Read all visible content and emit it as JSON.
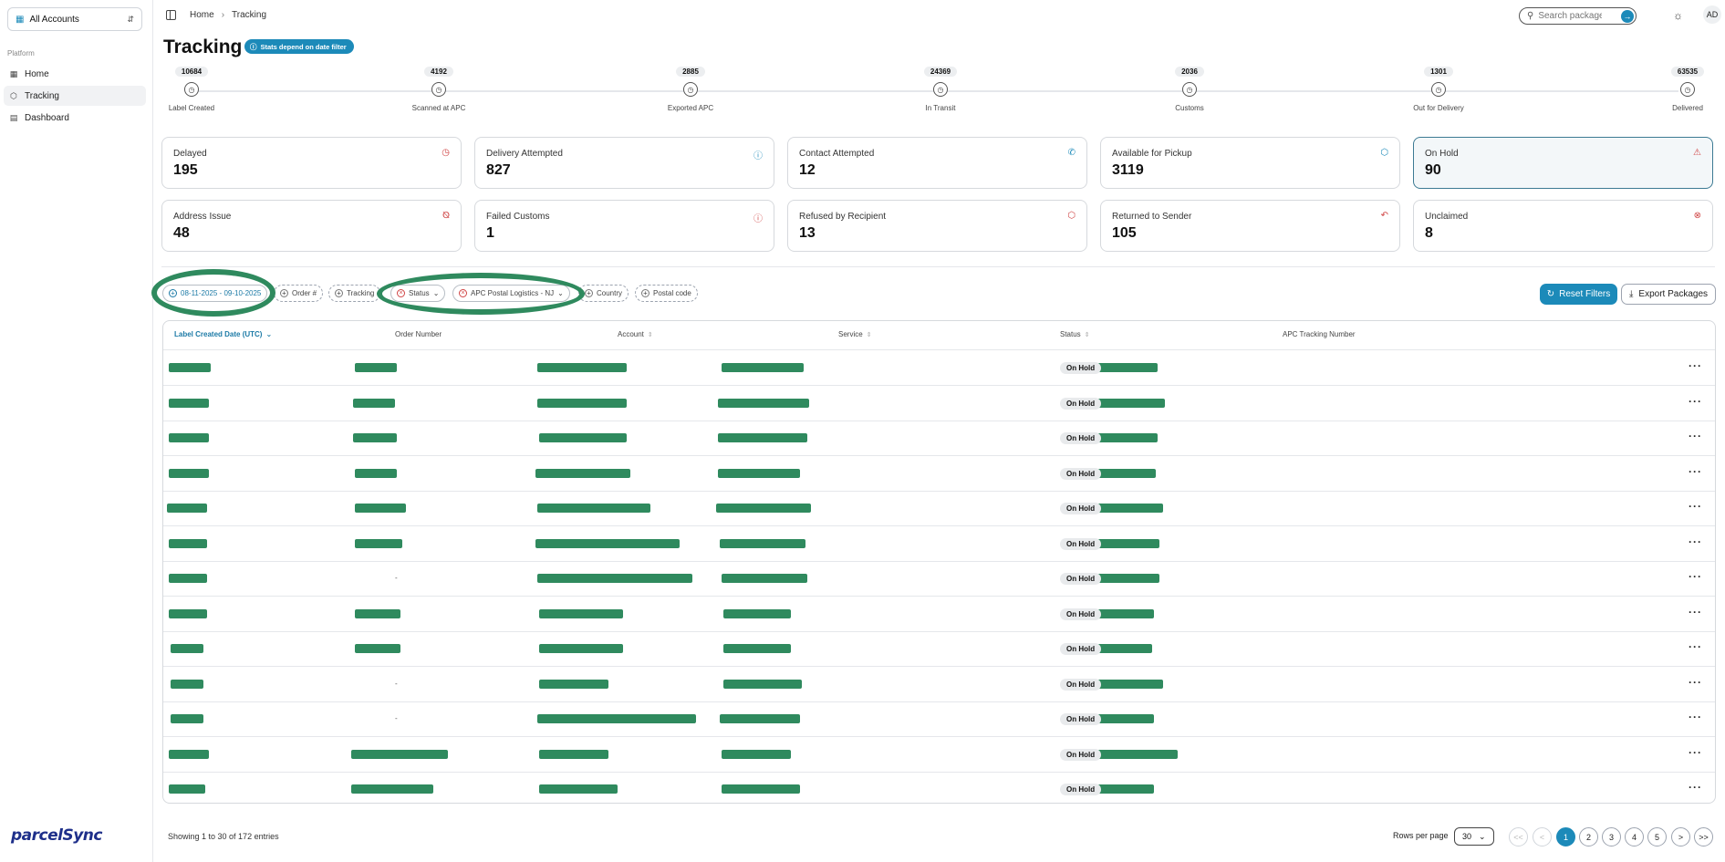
{
  "sidebar": {
    "account_select": "All Accounts",
    "section": "Platform",
    "items": [
      {
        "label": "Home",
        "icon": "grid-icon"
      },
      {
        "label": "Tracking",
        "icon": "package-icon"
      },
      {
        "label": "Dashboard",
        "icon": "document-icon"
      }
    ],
    "brand": "parcelSync"
  },
  "header": {
    "breadcrumb": [
      "Home",
      "Tracking"
    ],
    "search_placeholder": "Search packages...",
    "avatar": "AD"
  },
  "page": {
    "title": "Tracking",
    "stats_badge": "Stats depend on date filter"
  },
  "steps": [
    {
      "count": "10684",
      "label": "Label Created"
    },
    {
      "count": "4192",
      "label": "Scanned at APC"
    },
    {
      "count": "2885",
      "label": "Exported APC"
    },
    {
      "count": "24369",
      "label": "In Transit"
    },
    {
      "count": "2036",
      "label": "Customs"
    },
    {
      "count": "1301",
      "label": "Out for Delivery"
    },
    {
      "count": "63535",
      "label": "Delivered"
    }
  ],
  "cards": [
    {
      "name": "Delayed",
      "value": "195",
      "icon": "clock-icon",
      "color": "#d04545"
    },
    {
      "name": "Delivery Attempted",
      "value": "827",
      "icon": "help-circle-icon",
      "color": "#1c8ab9"
    },
    {
      "name": "Contact Attempted",
      "value": "12",
      "icon": "phone-icon",
      "color": "#1c8ab9"
    },
    {
      "name": "Available for Pickup",
      "value": "3119",
      "icon": "box-icon",
      "color": "#1c8ab9"
    },
    {
      "name": "On Hold",
      "value": "90",
      "icon": "alert-triangle-icon",
      "color": "#d04545"
    },
    {
      "name": "Address Issue",
      "value": "48",
      "icon": "map-pin-off-icon",
      "color": "#d04545"
    },
    {
      "name": "Failed Customs",
      "value": "1",
      "icon": "alert-circle-icon",
      "color": "#d04545"
    },
    {
      "name": "Refused by Recipient",
      "value": "13",
      "icon": "box-x-icon",
      "color": "#d04545"
    },
    {
      "name": "Returned to Sender",
      "value": "105",
      "icon": "undo-icon",
      "color": "#d04545"
    },
    {
      "name": "Unclaimed",
      "value": "8",
      "icon": "x-circle-icon",
      "color": "#d04545"
    }
  ],
  "filters": {
    "date": "08-11-2025 - 09-10-2025",
    "order": "Order #",
    "tracking": "Tracking",
    "status": "Status",
    "account": "APC Postal Logistics - NJ",
    "country": "Country",
    "postal": "Postal code",
    "reset": "Reset Filters",
    "export": "Export Packages"
  },
  "table": {
    "columns": [
      "Label Created Date (UTC)",
      "Order Number",
      "Account",
      "Service",
      "Status",
      "APC Tracking Number"
    ],
    "rows": [
      {
        "order": "",
        "status": "On Hold"
      },
      {
        "order": "",
        "status": "On Hold"
      },
      {
        "order": "",
        "status": "On Hold"
      },
      {
        "order": "",
        "status": "On Hold"
      },
      {
        "order": "",
        "status": "On Hold"
      },
      {
        "order": "",
        "status": "On Hold"
      },
      {
        "order": "-",
        "status": "On Hold"
      },
      {
        "order": "",
        "status": "On Hold"
      },
      {
        "order": "",
        "status": "On Hold"
      },
      {
        "order": "-",
        "status": "On Hold"
      },
      {
        "order": "-",
        "status": "On Hold"
      },
      {
        "order": "",
        "status": "On Hold"
      },
      {
        "order": "",
        "status": "On Hold"
      }
    ]
  },
  "footer": {
    "showing": "Showing 1 to 30 of 172 entries",
    "rows_per_page_label": "Rows per page",
    "rows_per_page": "30",
    "pages": [
      "1",
      "2",
      "3",
      "4",
      "5"
    ],
    "current_page": "1"
  }
}
